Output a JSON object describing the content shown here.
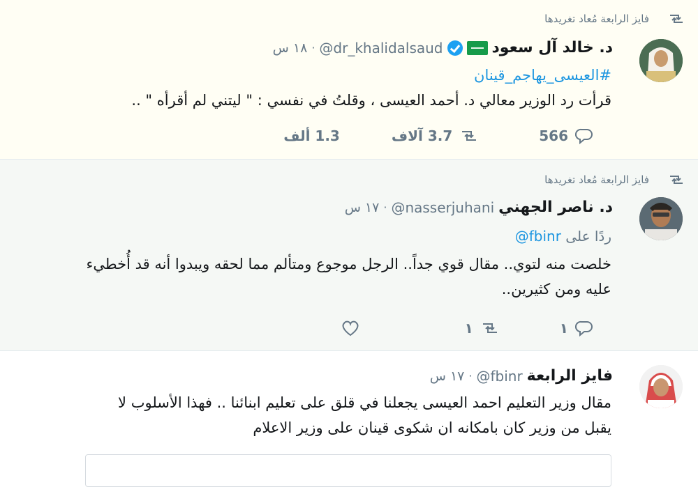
{
  "tweets": [
    {
      "retweet_label": "فايز الرابعة مُعاد تغريدها",
      "author_name": "د. خالد آل سعود",
      "handle": "@dr_khalidalsaud",
      "separator": "·",
      "time": "١٨ س",
      "hashtag": "#العيسى_يهاجم_قينان",
      "text": "قرأت رد الوزير معالي د. أحمد العيسى ، وقلتُ في نفسي : \" ليتني لم أقرأه \" ..",
      "replies": "566",
      "retweets": "3.7 آلاف",
      "likes": "1.3 ألف"
    },
    {
      "retweet_label": "فايز الرابعة مُعاد تغريدها",
      "author_name": "د. ناصر الجهني",
      "handle": "@nasserjuhani",
      "separator": "·",
      "time": "١٧ س",
      "reply_prefix": "ردًا على",
      "reply_handle": "@fbinr",
      "text_line1": "خلصت منه لتوي.. مقال قوي جداً.. الرجل موجوع ومتألم مما لحقه ويبدوا أنه قد أُخطيء",
      "text_line2": "عليه ومن كثيرين..",
      "replies": "١",
      "retweets": "١",
      "likes": ""
    },
    {
      "author_name": "فايز الرابعة",
      "handle": "@fbinr",
      "separator": "·",
      "time": "١٧ س",
      "text_line1": "مقال وزير التعليم احمد العيسى يجعلنا في قلق على تعليم ابنائنا .. فهذا الأسلوب لا",
      "text_line2": "يقبل من وزير كان بامكانه ان شكوى قينان على وزير الاعلام"
    }
  ],
  "icons": {
    "retweet": "retweet-icon",
    "reply": "reply-icon",
    "like": "heart-icon",
    "verified": "verified-badge-icon",
    "flag": "saudi-flag-icon"
  },
  "colors": {
    "link": "#1b95e0",
    "muted": "#657786",
    "verified": "#1da1f2",
    "highlight_bg": "#fffef4"
  }
}
